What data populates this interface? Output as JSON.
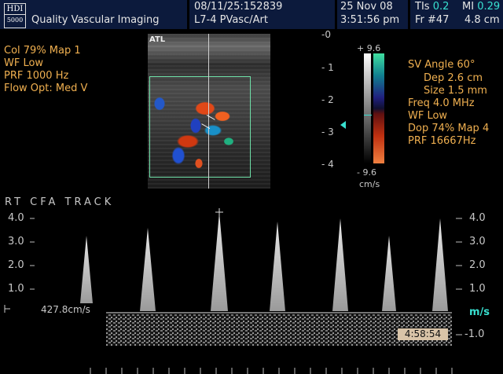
{
  "header": {
    "logo_top": "HDI",
    "logo_bottom": "5000",
    "institution": "Quality Vascular Imaging",
    "patient_id": "08/11/25:152839",
    "transducer": "L7-4 PVasc/Art",
    "date": "25 Nov 08",
    "time": "3:51:56 pm",
    "ti_label": "TIs",
    "ti_value": "0.2",
    "mi_label": "MI",
    "mi_value": "0.29",
    "frame": "Fr #47",
    "depth": "4.8 cm"
  },
  "left_params": [
    "Col 79%  Map 1",
    "WF Low",
    "PRF 1000  Hz",
    "Flow Opt: Med V"
  ],
  "right_params": [
    "SV Angle 60°",
    "Dep 2.6  cm",
    "Size 1.5  mm",
    "Freq 4.0  MHz",
    "WF Low",
    "Dop 74%  Map 4",
    "PRF 16667Hz"
  ],
  "image_logo": "ATL",
  "depth_scale": [
    "-0",
    "- 1",
    "- 2",
    "- 3",
    "- 4"
  ],
  "color_bar": {
    "top": "+ 9.6",
    "bottom": "- 9.6",
    "unit": "cm/s"
  },
  "trace_label": "RT  CFA  TRACK",
  "velocity_readout": "427.8cm/s",
  "left_axis": [
    "4.0",
    "3.0",
    "2.0",
    "1.0"
  ],
  "right_axis": [
    "4.0",
    "3.0",
    "2.0",
    "1.0"
  ],
  "right_neg": "-1.0",
  "units": "m/s",
  "timer": "4:58:54",
  "colors": {
    "orange": "#f0b050",
    "cyan": "#38e0d0",
    "header": "#0c1a3c",
    "roi": "#6ee0a8"
  }
}
